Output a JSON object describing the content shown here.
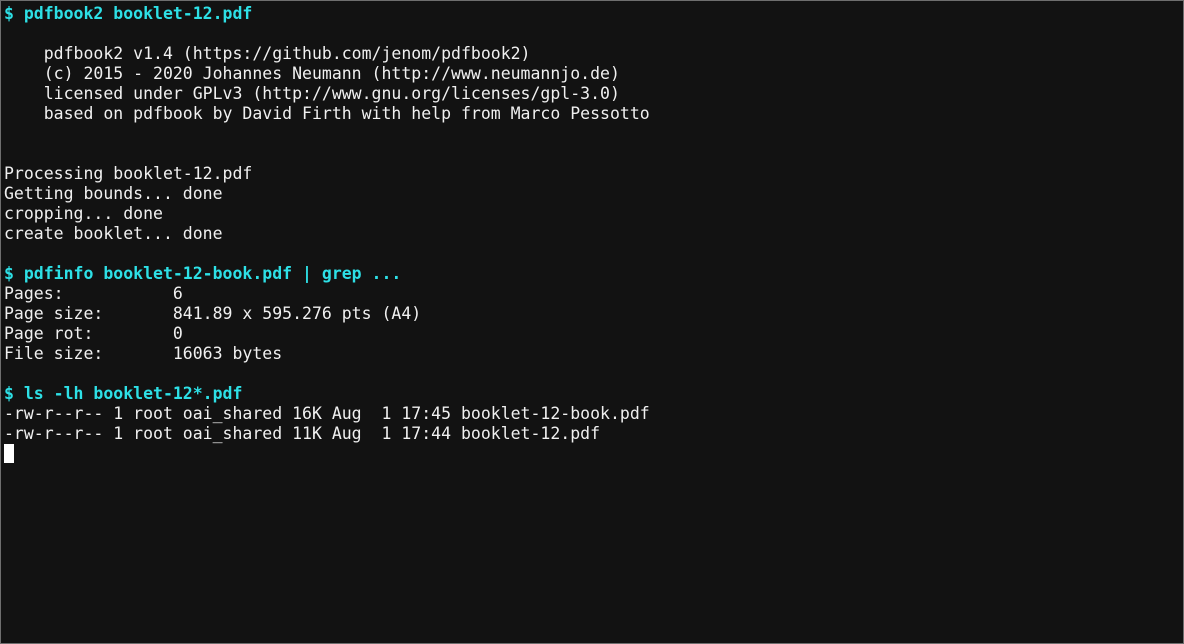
{
  "terminal": {
    "cmd1": "$ pdfbook2 booklet-12.pdf",
    "banner": [
      "    pdfbook2 v1.4 (https://github.com/jenom/pdfbook2)",
      "    (c) 2015 - 2020 Johannes Neumann (http://www.neumannjo.de)",
      "    licensed under GPLv3 (http://www.gnu.org/licenses/gpl-3.0)",
      "    based on pdfbook by David Firth with help from Marco Pessotto"
    ],
    "processing": [
      "Processing booklet-12.pdf",
      "Getting bounds... done",
      "cropping... done",
      "create booklet... done"
    ],
    "cmd2": "$ pdfinfo booklet-12-book.pdf | grep ...",
    "pdfinfo": [
      "Pages:           6",
      "Page size:       841.89 x 595.276 pts (A4)",
      "Page rot:        0",
      "File size:       16063 bytes"
    ],
    "cmd3": "$ ls -lh booklet-12*.pdf",
    "ls": [
      "-rw-r--r-- 1 root oai_shared 16K Aug  1 17:45 booklet-12-book.pdf",
      "-rw-r--r-- 1 root oai_shared 11K Aug  1 17:44 booklet-12.pdf"
    ]
  }
}
